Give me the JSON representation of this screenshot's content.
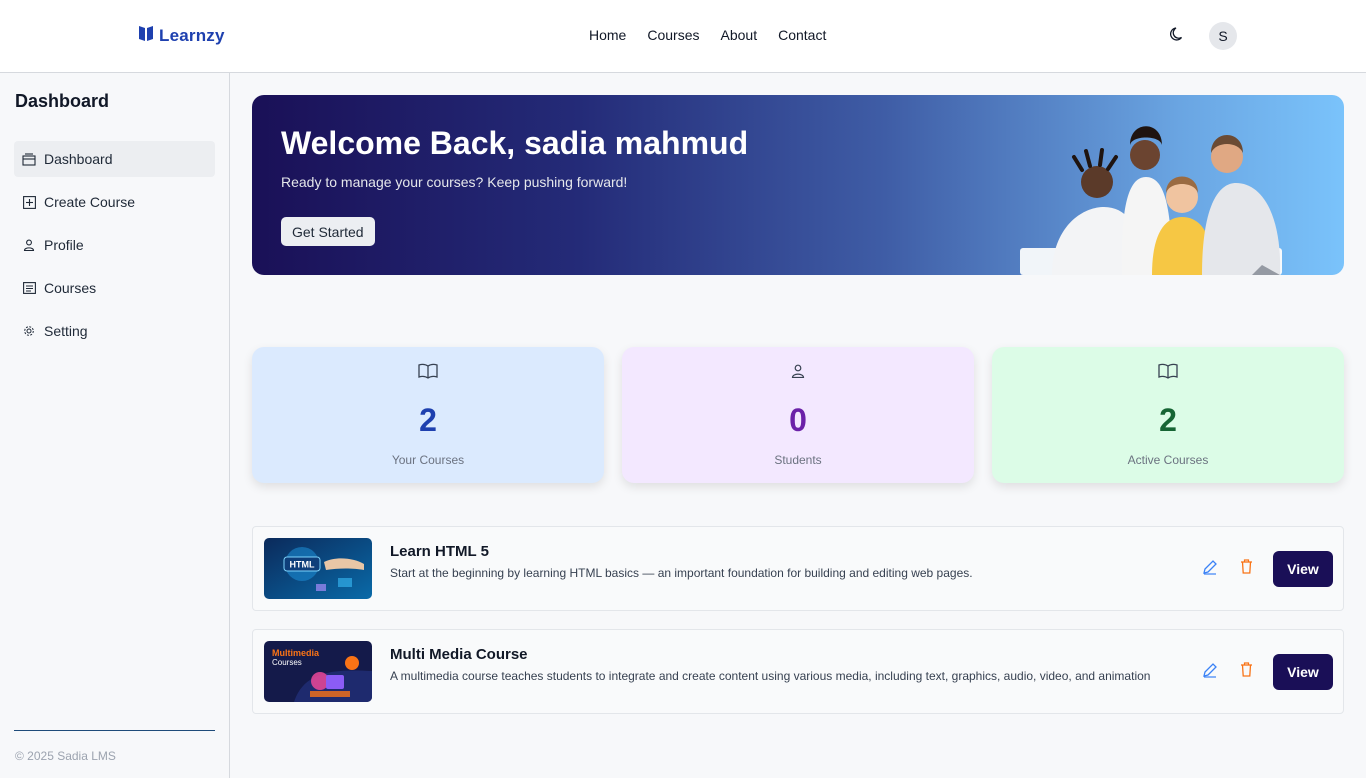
{
  "brand": {
    "name": "Learnzy",
    "color": "#1e40af"
  },
  "nav": {
    "links": [
      "Home",
      "Courses",
      "About",
      "Contact"
    ]
  },
  "header": {
    "theme_toggle_icon": "moon-icon",
    "avatar_initial": "S"
  },
  "sidebar": {
    "title": "Dashboard",
    "items": [
      {
        "label": "Dashboard",
        "icon": "dashboard-icon",
        "active": true
      },
      {
        "label": "Create Course",
        "icon": "plus-square-icon",
        "active": false
      },
      {
        "label": "Profile",
        "icon": "user-icon",
        "active": false
      },
      {
        "label": "Courses",
        "icon": "list-icon",
        "active": false
      },
      {
        "label": "Setting",
        "icon": "gear-icon",
        "active": false
      }
    ],
    "copyright": "© 2025 Sadia LMS"
  },
  "hero": {
    "title": "Welcome Back, sadia mahmud",
    "subtitle": "Ready to manage your courses? Keep pushing forward!",
    "button_label": "Get Started"
  },
  "stats": [
    {
      "value": "2",
      "label": "Your Courses",
      "icon": "book-open-icon",
      "bg": "#dbeafe",
      "color": "#1e40af"
    },
    {
      "value": "0",
      "label": "Students",
      "icon": "user-icon",
      "bg": "#f3e8ff",
      "color": "#6b21a8"
    },
    {
      "value": "2",
      "label": "Active Courses",
      "icon": "book-open-icon",
      "bg": "#dcfce7",
      "color": "#166534"
    }
  ],
  "courses": [
    {
      "title": "Learn HTML 5",
      "description": "Start at the beginning by learning HTML basics — an important foundation for building and editing web pages.",
      "thumb_text": "HTML",
      "view_label": "View"
    },
    {
      "title": "Multi Media Course",
      "description": "A multimedia course teaches students to integrate and create content using various media, including text, graphics, audio, video, and animation",
      "thumb_text": "Multimedia",
      "thumb_subtext": "Courses",
      "view_label": "View"
    }
  ]
}
